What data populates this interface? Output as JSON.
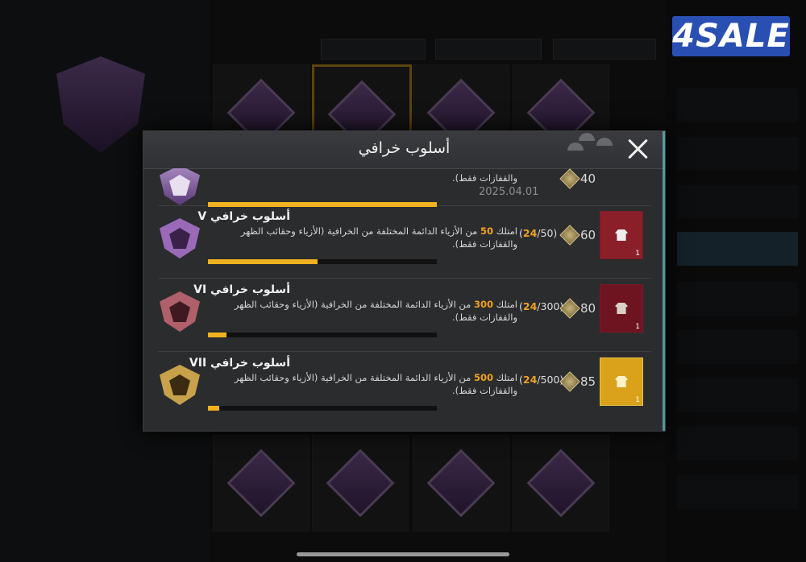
{
  "logo": {
    "text": "4SALE",
    "color": "#2a4fb3"
  },
  "dialog": {
    "title": "أسلوب خرافي",
    "top_partial": {
      "desc_line": "والقفازات فقط).",
      "date": "2025.04.01",
      "points": "40",
      "progress_fraction": 1.0
    },
    "rows": [
      {
        "name": "أسلوب خرافي V",
        "desc_prefix": "امتلك ",
        "desc_number": "50",
        "desc_suffix": " من الأزياء الدائمة المختلفة من الخرافية (الأزياء وحقائب الظهر والقفازات فقط).",
        "progress_current": "24",
        "progress_total": "/50)",
        "progress_open": "(",
        "points": "60",
        "reward_count": "1",
        "progress_fraction": 0.48,
        "emblem_color": "#9a6ab8",
        "reward_bg": "#8a1f2a"
      },
      {
        "name": "أسلوب خرافي VI",
        "desc_prefix": "امتلك ",
        "desc_number": "300",
        "desc_suffix": " من الأزياء الدائمة المختلفة من الخرافية (الأزياء وحقائب الظهر والقفازات فقط).",
        "progress_current": "24",
        "progress_total": "/300)",
        "progress_open": "(",
        "points": "80",
        "reward_count": "1",
        "progress_fraction": 0.08,
        "emblem_color": "#b0606a",
        "reward_bg": "#6e1420"
      },
      {
        "name": "أسلوب خرافي VII",
        "desc_prefix": "امتلك ",
        "desc_number": "500",
        "desc_suffix": " من الأزياء الدائمة المختلفة من الخرافية (الأزياء وحقائب الظهر والقفازات فقط).",
        "progress_current": "24",
        "progress_total": "/500)",
        "progress_open": "(",
        "points": "85",
        "reward_count": "1",
        "progress_fraction": 0.048,
        "emblem_color": "#c7a24a",
        "reward_bg": "#d9a21a"
      }
    ]
  },
  "colors": {
    "accent": "#f2a21c",
    "progress": "#f0b21f"
  },
  "icons": {
    "close": "close-icon",
    "coin": "coin-icon",
    "emblem": "shield-emblem-icon",
    "reward": "jacket-icon"
  }
}
